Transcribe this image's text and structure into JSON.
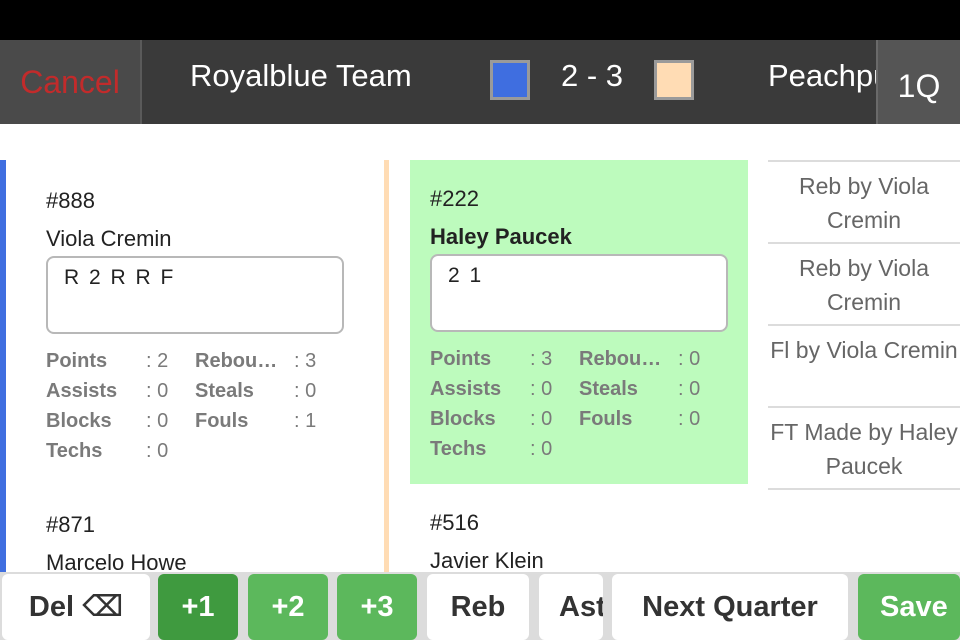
{
  "header": {
    "cancel_label": "Cancel",
    "home_team": "Royalblue Team",
    "score": "2 - 3",
    "away_team": "Peachpuff Team",
    "quarter": "1Q",
    "home_color": "#3f6ee0",
    "away_color": "#ffdcb4"
  },
  "home_players": [
    {
      "number": "#888",
      "name": "Viola Cremin",
      "notes": "R 2 R R F",
      "stats": {
        "points_label": "Points",
        "points": ": 2",
        "rebounds_label": "Rebou…",
        "rebounds": ": 3",
        "assists_label": "Assists",
        "assists": ": 0",
        "steals_label": "Steals",
        "steals": ": 0",
        "blocks_label": "Blocks",
        "blocks": ": 0",
        "fouls_label": "Fouls",
        "fouls": ": 1",
        "techs_label": "Techs",
        "techs": ": 0"
      }
    },
    {
      "number": "#871",
      "name": "Marcelo Howe"
    }
  ],
  "away_players": [
    {
      "number": "#222",
      "name": "Haley Paucek",
      "notes": "2 1",
      "stats": {
        "points_label": "Points",
        "points": ": 3",
        "rebounds_label": "Rebou…",
        "rebounds": ": 0",
        "assists_label": "Assists",
        "assists": ": 0",
        "steals_label": "Steals",
        "steals": ": 0",
        "blocks_label": "Blocks",
        "blocks": ": 0",
        "fouls_label": "Fouls",
        "fouls": ": 0",
        "techs_label": "Techs",
        "techs": ": 0"
      }
    },
    {
      "number": "#516",
      "name": "Javier Klein"
    }
  ],
  "play_log": [
    "Reb by Viola Cremin",
    "Reb by Viola Cremin",
    "Fl by Viola Cremin",
    "FT Made by Haley Paucek"
  ],
  "toolbar": {
    "delete_label": "Del ⌫",
    "plus1_label": "+1",
    "plus2_label": "+2",
    "plus3_label": "+3",
    "reb_label": "Reb",
    "ast_label": "Ast",
    "next_quarter_label": "Next Quarter",
    "save_label": "Save"
  }
}
